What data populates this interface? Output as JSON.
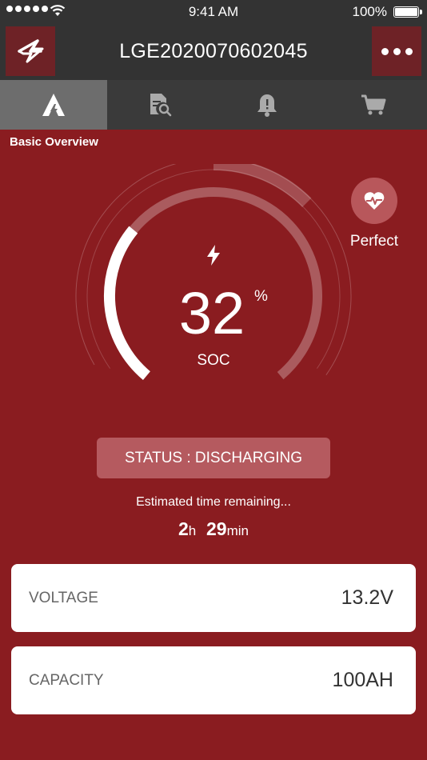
{
  "status_bar": {
    "time": "9:41 AM",
    "battery_percent": "100%",
    "battery_level": 1.0
  },
  "nav": {
    "title": "LGE2020070602045",
    "back_icon": "back-arrow-logo-icon",
    "more_icon": "more-dots-icon"
  },
  "tabs": [
    {
      "icon": "overview-logo-icon",
      "active": true
    },
    {
      "icon": "report-search-icon",
      "active": false
    },
    {
      "icon": "alarm-bell-icon",
      "active": false
    },
    {
      "icon": "shopping-cart-icon",
      "active": false
    }
  ],
  "section": {
    "label": "Basic Overview"
  },
  "battery": {
    "soc_value": "32",
    "soc_unit": "%",
    "soc_fraction": 0.32,
    "soc_label": "SOC",
    "health_label": "Perfect",
    "status_text": "STATUS : DISCHARGING",
    "eta_label": "Estimated time remaining...",
    "eta_hours": "2",
    "eta_hours_unit": "h",
    "eta_minutes": "29",
    "eta_minutes_unit": "min"
  },
  "cards": {
    "voltage_label": "VOLTAGE",
    "voltage_value": "13.2V",
    "capacity_label": "CAPACITY",
    "capacity_value": "100AH"
  },
  "colors": {
    "background": "#8a1c20",
    "bar": "#333333",
    "health_circle": "#b8575b",
    "status_pill": "#b55a5f"
  }
}
